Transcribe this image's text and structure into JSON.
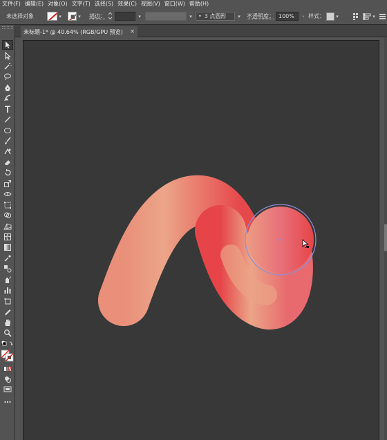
{
  "menu": [
    "文件(F)",
    "编辑(E)",
    "对象(O)",
    "文字(T)",
    "选择(S)",
    "效果(C)",
    "视图(V)",
    "窗口(W)",
    "帮助(H)"
  ],
  "control_bar": {
    "selection_status": "未选择对象",
    "stroke_label": "描边：",
    "stroke_value": "",
    "brush_label": "3 点圆形",
    "opacity_label": "不透明度：",
    "opacity_value": "100%",
    "style_label": "样式："
  },
  "document_tab": {
    "title": "未标题-1* @ 40.64% (RGB/GPU 预览)",
    "close": "×"
  },
  "artwork": {
    "shape": "s-curve-blend",
    "gradient_start": "#e64448",
    "gradient_light": "#eca588",
    "gradient_mid": "#e88a78",
    "selection_circle_color": "#8d8fdc"
  },
  "colors": {
    "ui_panel": "#535353",
    "artboard": "#383838",
    "accent_red": "#e02020"
  }
}
